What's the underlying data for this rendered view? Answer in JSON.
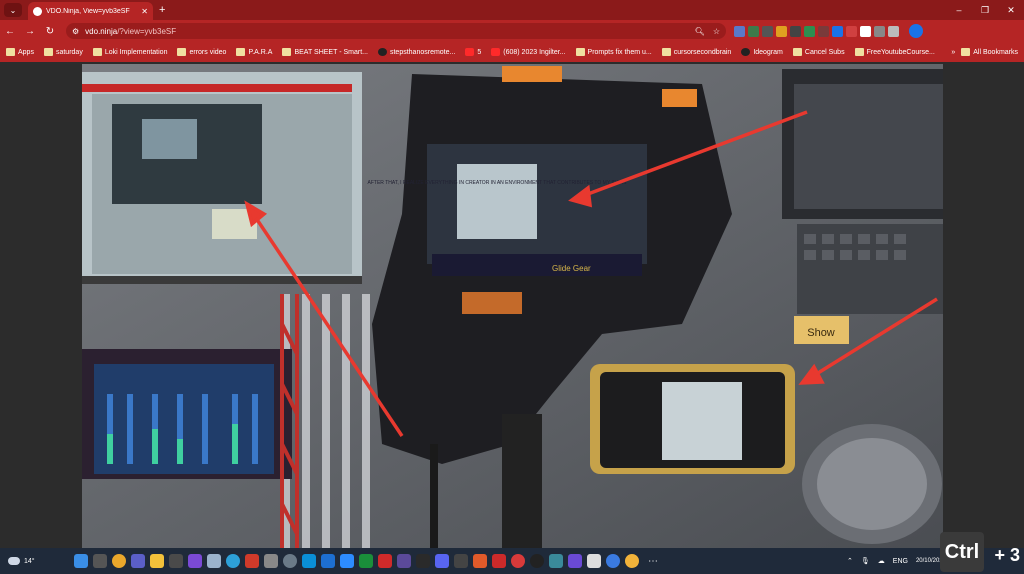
{
  "browser": {
    "tab_title": "VDO.Ninja, View=yvb3eSF",
    "tab_close": "✕",
    "new_tab": "+",
    "url_host": "vdo.ninja",
    "url_path": "/?view=yvb3eSF",
    "window": {
      "minimize": "–",
      "maximize": "❐",
      "close": "✕"
    }
  },
  "bookmarks": [
    {
      "label": "Apps",
      "icon": "apps"
    },
    {
      "label": "saturday",
      "icon": "folder"
    },
    {
      "label": "Loki Implementation",
      "icon": "folder"
    },
    {
      "label": "errors video",
      "icon": "folder"
    },
    {
      "label": "P.A.R.A",
      "icon": "folder"
    },
    {
      "label": "BEAT SHEET - Smart...",
      "icon": "check"
    },
    {
      "label": "stepsthanosremote...",
      "icon": "github"
    },
    {
      "label": "5",
      "icon": "youtube"
    },
    {
      "label": "(608) 2023 Ingilter...",
      "icon": "youtube"
    },
    {
      "label": "Prompts fix them u...",
      "icon": "doc"
    },
    {
      "label": "cursorsecondbrain",
      "icon": "folder"
    },
    {
      "label": "Ideogram",
      "icon": "circle"
    },
    {
      "label": "Cancel Subs",
      "icon": "folder"
    },
    {
      "label": "FreeYoutubeCourse...",
      "icon": "play"
    }
  ],
  "all_bookmarks": "All Bookmarks",
  "video": {
    "prompter_text": "AFTER THAT, I REALIZE EVERYTHING IN CREATOR IN AN ENVIRONMENT THAT CONTRIBUTES TO MY IDEAS",
    "brand_label": "Glide Gear",
    "note_label": "Show"
  },
  "taskbar": {
    "temperature": "14°",
    "lang": "ENG",
    "date": "20/10/2024"
  },
  "overlay": {
    "ctrl": "Ctrl",
    "plus3": "+ 3"
  },
  "colors": {
    "browser_frame": "#b52525",
    "arrow": "#e8392f",
    "taskbar": "#1f2a3a"
  }
}
